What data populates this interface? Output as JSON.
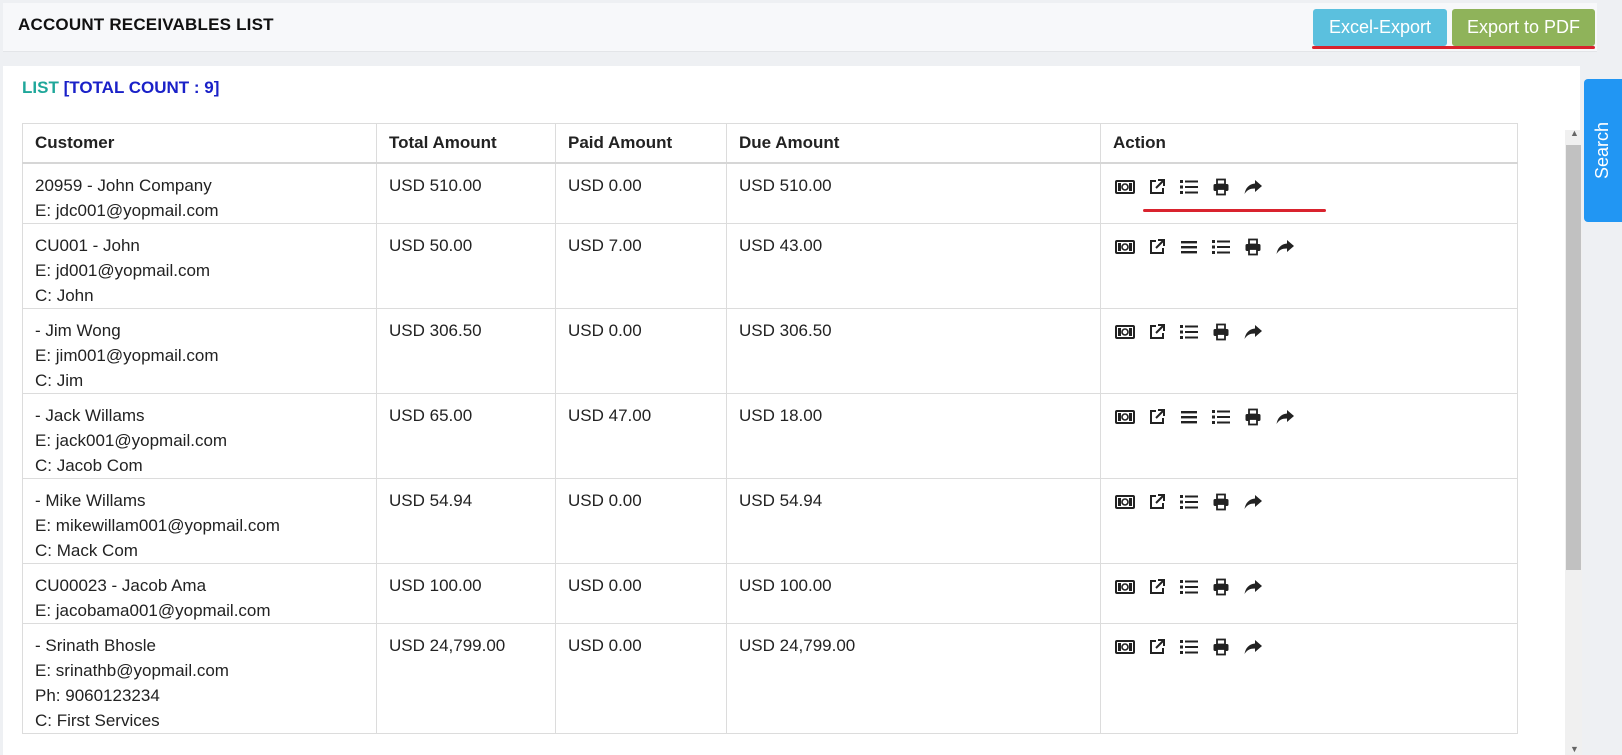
{
  "page": {
    "title": "ACCOUNT RECEIVABLES LIST",
    "excel_button": "Excel-Export",
    "pdf_button": "Export to PDF",
    "list_label": "LIST",
    "total_count_label": "[TOTAL COUNT : 9]",
    "search_tab": "Search"
  },
  "colors": {
    "excel_button": "#5bc0de",
    "pdf_button": "#8fb35a",
    "list_label": "#1fa79a",
    "total_count": "#1a21c8",
    "annotation_underline": "#d9232e",
    "search_tab": "#2196f3"
  },
  "table": {
    "columns": [
      "Customer",
      "Total Amount",
      "Paid Amount",
      "Due Amount",
      "Action"
    ],
    "rows": [
      {
        "customer": [
          "20959 - John Company",
          "E: jdc001@yopmail.com"
        ],
        "total": "USD 510.00",
        "paid": "USD 0.00",
        "due": "USD 510.00",
        "actions": [
          "cash-icon",
          "external-link-icon",
          "list-icon",
          "print-icon",
          "share-icon"
        ]
      },
      {
        "customer": [
          "CU001 - John",
          "E: jd001@yopmail.com",
          "C: John"
        ],
        "total": "USD 50.00",
        "paid": "USD 7.00",
        "due": "USD 43.00",
        "actions": [
          "cash-icon",
          "external-link-icon",
          "menu-icon",
          "list-icon",
          "print-icon",
          "share-icon"
        ]
      },
      {
        "customer": [
          "- Jim Wong",
          "E: jim001@yopmail.com",
          "C: Jim"
        ],
        "total": "USD 306.50",
        "paid": "USD 0.00",
        "due": "USD 306.50",
        "actions": [
          "cash-icon",
          "external-link-icon",
          "list-icon",
          "print-icon",
          "share-icon"
        ]
      },
      {
        "customer": [
          "- Jack Willams",
          "E: jack001@yopmail.com",
          "C: Jacob Com"
        ],
        "total": "USD 65.00",
        "paid": "USD 47.00",
        "due": "USD 18.00",
        "actions": [
          "cash-icon",
          "external-link-icon",
          "menu-icon",
          "list-icon",
          "print-icon",
          "share-icon"
        ]
      },
      {
        "customer": [
          "- Mike Willams",
          "E: mikewillam001@yopmail.com",
          "C: Mack Com"
        ],
        "total": "USD 54.94",
        "paid": "USD 0.00",
        "due": "USD 54.94",
        "actions": [
          "cash-icon",
          "external-link-icon",
          "list-icon",
          "print-icon",
          "share-icon"
        ]
      },
      {
        "customer": [
          "CU00023 - Jacob Ama",
          "E: jacobama001@yopmail.com"
        ],
        "total": "USD 100.00",
        "paid": "USD 0.00",
        "due": "USD 100.00",
        "actions": [
          "cash-icon",
          "external-link-icon",
          "list-icon",
          "print-icon",
          "share-icon"
        ]
      },
      {
        "customer": [
          "- Srinath Bhosle",
          "E: srinathb@yopmail.com",
          "Ph: 9060123234",
          "C: First Services"
        ],
        "total": "USD 24,799.00",
        "paid": "USD 0.00",
        "due": "USD 24,799.00",
        "actions": [
          "cash-icon",
          "external-link-icon",
          "list-icon",
          "print-icon",
          "share-icon"
        ]
      }
    ]
  }
}
